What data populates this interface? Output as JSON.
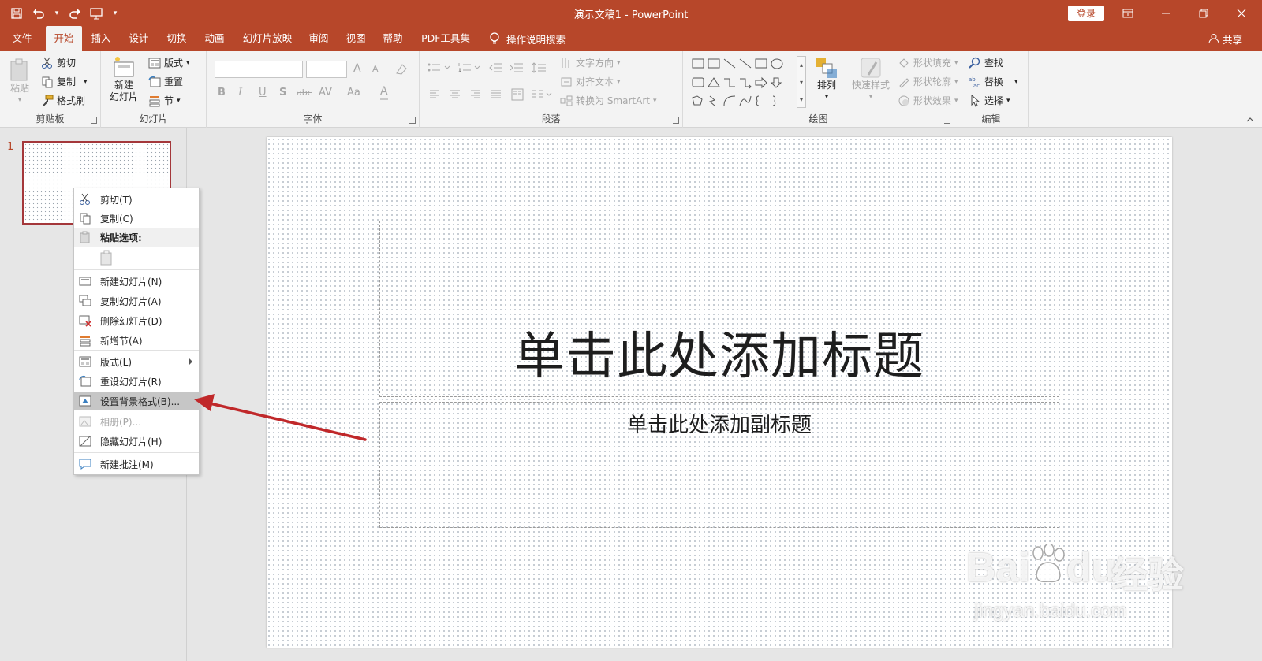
{
  "window": {
    "title": "演示文稿1  -  PowerPoint",
    "login": "登录",
    "share": "共享"
  },
  "tabs": [
    "文件",
    "开始",
    "插入",
    "设计",
    "切换",
    "动画",
    "幻灯片放映",
    "审阅",
    "视图",
    "帮助",
    "PDF工具集"
  ],
  "search": "操作说明搜索",
  "ribbon": {
    "clipboard": {
      "label": "剪贴板",
      "paste": "粘贴",
      "cut": "剪切",
      "copy": "复制",
      "format_painter": "格式刷"
    },
    "slides": {
      "label": "幻灯片",
      "new_slide_1": "新建",
      "new_slide_2": "幻灯片",
      "layout": "版式",
      "reset": "重置",
      "section": "节"
    },
    "font": {
      "label": "字体",
      "bold": "B",
      "italic": "I",
      "underline": "U",
      "shadow": "S",
      "strike": "abc",
      "spacing": "AV",
      "case": "Aa",
      "color": "A",
      "grow": "A",
      "shrink": "A"
    },
    "paragraph": {
      "label": "段落",
      "text_direction": "文字方向",
      "align_text": "对齐文本",
      "smartart": "转换为 SmartArt"
    },
    "drawing": {
      "label": "绘图",
      "arrange": "排列",
      "quick_styles": "快速样式",
      "fill": "形状填充",
      "outline": "形状轮廓",
      "effects": "形状效果"
    },
    "editing": {
      "label": "编辑",
      "find": "查找",
      "replace": "替换",
      "select": "选择"
    }
  },
  "slides_pane": {
    "number": "1"
  },
  "slide": {
    "title_placeholder": "单击此处添加标题",
    "subtitle_placeholder": "单击此处添加副标题"
  },
  "context_menu": {
    "cut": "剪切(T)",
    "copy": "复制(C)",
    "paste_options": "粘贴选项:",
    "new_slide": "新建幻灯片(N)",
    "duplicate_slide": "复制幻灯片(A)",
    "delete_slide": "删除幻灯片(D)",
    "add_section": "新增节(A)",
    "layout": "版式(L)",
    "reset_slide": "重设幻灯片(R)",
    "format_background": "设置背景格式(B)...",
    "photo_album": "相册(P)...",
    "hide_slide": "隐藏幻灯片(H)",
    "new_comment": "新建批注(M)"
  },
  "watermark": {
    "brand": "Bai",
    "brand2": "du",
    "cn": "经验",
    "url": "jingyan.baidu.com"
  },
  "colors": {
    "accent": "#b7472a",
    "arrow": "#c0282a",
    "ribbon_bg": "#f3f3f3"
  }
}
